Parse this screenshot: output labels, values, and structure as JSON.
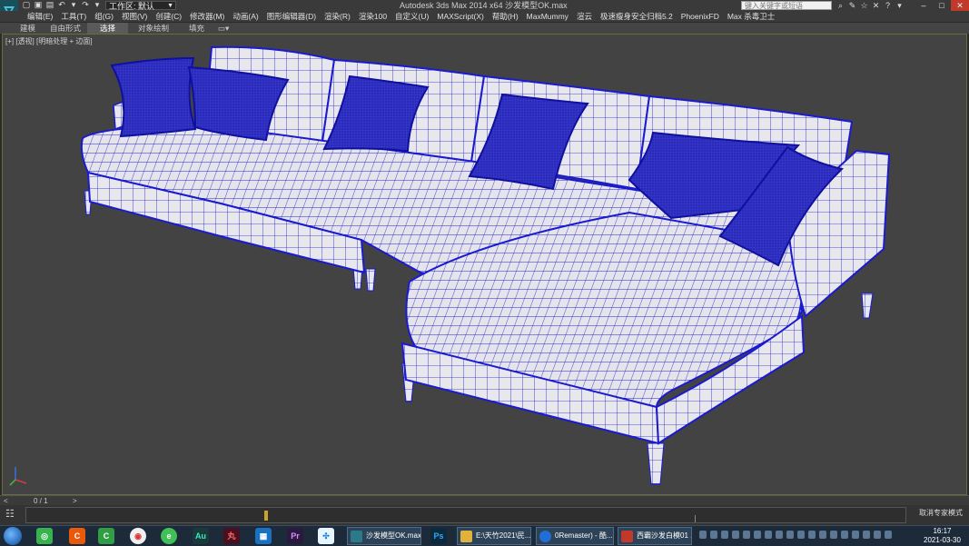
{
  "titlebar": {
    "workspace_label": "工作区: 默认",
    "title": "Autodesk 3ds Max  2014 x64    沙发模型OK.max",
    "search_placeholder": "键入关键字或短语"
  },
  "menu": {
    "items": [
      "编辑(E)",
      "工具(T)",
      "组(G)",
      "视图(V)",
      "创建(C)",
      "修改器(M)",
      "动画(A)",
      "图形编辑器(D)",
      "渲染(R)",
      "渲染100",
      "自定义(U)",
      "MAXScript(X)",
      "帮助(H)",
      "MaxMummy",
      "渲云",
      "极速瘦身安全归档5.2",
      "PhoenixFD",
      "Max 杀毒卫士"
    ]
  },
  "ribbon": {
    "tabs": [
      "建模",
      "自由形式",
      "选择",
      "对象绘制",
      "填充"
    ],
    "active_tab": "选择"
  },
  "viewport": {
    "label": "[+] [透视] [明暗处理 + 边面]"
  },
  "timeline": {
    "frame_counter": "0 / 1",
    "prev_arrow": "<",
    "next_arrow": ">"
  },
  "status": {
    "text": "取消专家模式"
  },
  "taskbar": {
    "tasks": [
      {
        "label": "沙发模型OK.max...",
        "color": "#2b7a8a"
      },
      {
        "label": "E:\\天竹2021\\民...",
        "color": "#e0b23c"
      },
      {
        "label": "0Remaster) - 酷...",
        "color": "#1f6fd6"
      },
      {
        "label": "西霸沙发白模01 ...",
        "color": "#c0392b"
      }
    ],
    "time": "16:17",
    "date": "2021-03-30"
  },
  "colors": {
    "wireframe": "#1a1ad0",
    "surface": "#e6e6ea",
    "viewport_bg": "#434343"
  }
}
